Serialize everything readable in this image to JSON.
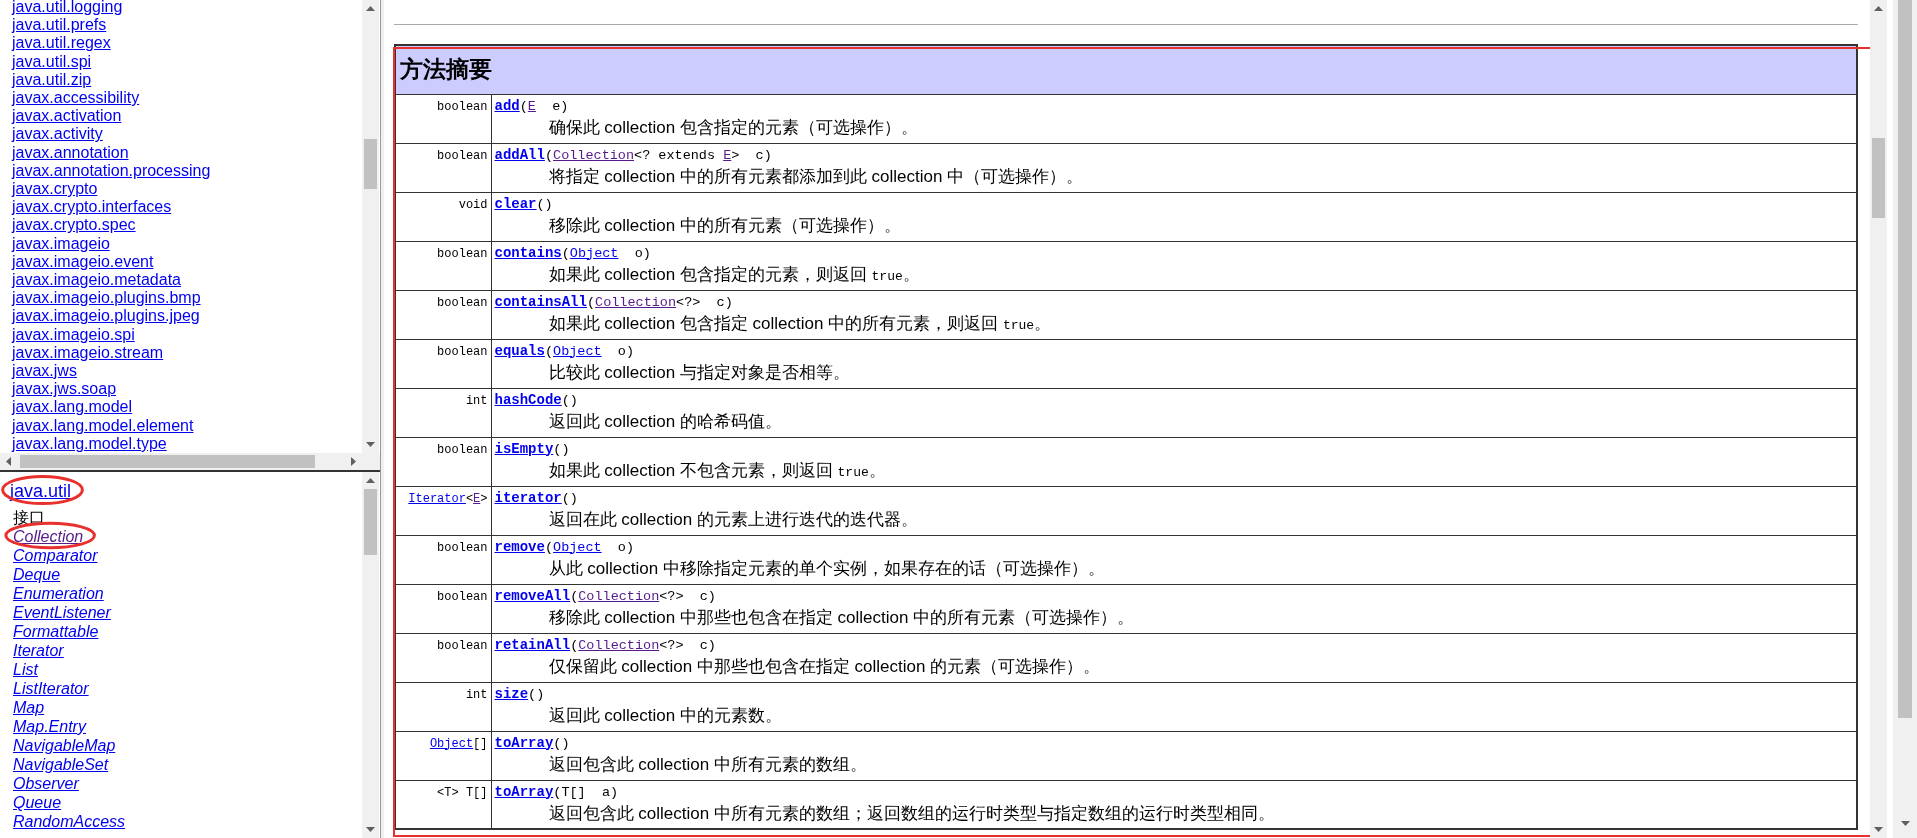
{
  "packages": [
    {
      "label": "java.util.logging"
    },
    {
      "label": "java.util.prefs"
    },
    {
      "label": "java.util.regex"
    },
    {
      "label": "java.util.spi"
    },
    {
      "label": "java.util.zip"
    },
    {
      "label": "javax.accessibility"
    },
    {
      "label": "javax.activation"
    },
    {
      "label": "javax.activity"
    },
    {
      "label": "javax.annotation"
    },
    {
      "label": "javax.annotation.processing"
    },
    {
      "label": "javax.crypto"
    },
    {
      "label": "javax.crypto.interfaces"
    },
    {
      "label": "javax.crypto.spec"
    },
    {
      "label": "javax.imageio"
    },
    {
      "label": "javax.imageio.event"
    },
    {
      "label": "javax.imageio.metadata"
    },
    {
      "label": "javax.imageio.plugins.bmp"
    },
    {
      "label": "javax.imageio.plugins.jpeg"
    },
    {
      "label": "javax.imageio.spi"
    },
    {
      "label": "javax.imageio.stream"
    },
    {
      "label": "javax.jws"
    },
    {
      "label": "javax.jws.soap"
    },
    {
      "label": "javax.lang.model"
    },
    {
      "label": "javax.lang.model.element"
    },
    {
      "label": "javax.lang.model.type"
    }
  ],
  "package_frame": {
    "title": "java.util",
    "title_circled": true,
    "section": "接口",
    "classes": [
      {
        "label": "Collection",
        "visited": true,
        "circled": true
      },
      {
        "label": "Comparator",
        "visited": false,
        "circled": false
      },
      {
        "label": "Deque",
        "visited": false,
        "circled": false
      },
      {
        "label": "Enumeration",
        "visited": false,
        "circled": false
      },
      {
        "label": "EventListener",
        "visited": false,
        "circled": false
      },
      {
        "label": "Formattable",
        "visited": false,
        "circled": false
      },
      {
        "label": "Iterator",
        "visited": false,
        "circled": false
      },
      {
        "label": "List",
        "visited": false,
        "circled": false
      },
      {
        "label": "ListIterator",
        "visited": false,
        "circled": false
      },
      {
        "label": "Map",
        "visited": false,
        "circled": false
      },
      {
        "label": "Map.Entry",
        "visited": false,
        "circled": false
      },
      {
        "label": "NavigableMap",
        "visited": false,
        "circled": false
      },
      {
        "label": "NavigableSet",
        "visited": false,
        "circled": false
      },
      {
        "label": "Observer",
        "visited": false,
        "circled": false
      },
      {
        "label": "Queue",
        "visited": false,
        "circled": false
      },
      {
        "label": "RandomAccess",
        "visited": false,
        "circled": false
      }
    ]
  },
  "method_summary": {
    "title": "方法摘要",
    "outlined": true,
    "rows": [
      {
        "returns": [
          {
            "kind": "plain",
            "text": "boolean"
          }
        ],
        "signature": [
          {
            "kind": "method",
            "text": "add"
          },
          {
            "kind": "plain",
            "text": "("
          },
          {
            "kind": "visited",
            "text": "E"
          },
          {
            "kind": "plain",
            "text": "  e)"
          }
        ],
        "description": [
          {
            "kind": "plain",
            "text": "确保此 collection 包含指定的元素（可选操作）。"
          }
        ]
      },
      {
        "returns": [
          {
            "kind": "plain",
            "text": "boolean"
          }
        ],
        "signature": [
          {
            "kind": "method",
            "text": "addAll"
          },
          {
            "kind": "plain",
            "text": "("
          },
          {
            "kind": "visited",
            "text": "Collection"
          },
          {
            "kind": "plain",
            "text": "<? extends "
          },
          {
            "kind": "visited",
            "text": "E"
          },
          {
            "kind": "plain",
            "text": ">  c)"
          }
        ],
        "description": [
          {
            "kind": "plain",
            "text": "将指定 collection 中的所有元素都添加到此 collection 中（可选操作）。"
          }
        ]
      },
      {
        "returns": [
          {
            "kind": "plain",
            "text": "void"
          }
        ],
        "signature": [
          {
            "kind": "method",
            "text": "clear"
          },
          {
            "kind": "plain",
            "text": "()"
          }
        ],
        "description": [
          {
            "kind": "plain",
            "text": "移除此 collection 中的所有元素（可选操作）。"
          }
        ]
      },
      {
        "returns": [
          {
            "kind": "plain",
            "text": "boolean"
          }
        ],
        "signature": [
          {
            "kind": "method",
            "text": "contains"
          },
          {
            "kind": "plain",
            "text": "("
          },
          {
            "kind": "link",
            "text": "Object"
          },
          {
            "kind": "plain",
            "text": "  o)"
          }
        ],
        "description": [
          {
            "kind": "plain",
            "text": "如果此 collection 包含指定的元素，则返回 "
          },
          {
            "kind": "code",
            "text": "true"
          },
          {
            "kind": "plain",
            "text": "。"
          }
        ]
      },
      {
        "returns": [
          {
            "kind": "plain",
            "text": "boolean"
          }
        ],
        "signature": [
          {
            "kind": "method",
            "text": "containsAll"
          },
          {
            "kind": "plain",
            "text": "("
          },
          {
            "kind": "visited",
            "text": "Collection"
          },
          {
            "kind": "plain",
            "text": "<?>  c)"
          }
        ],
        "description": [
          {
            "kind": "plain",
            "text": "如果此 collection 包含指定 collection 中的所有元素，则返回 "
          },
          {
            "kind": "code",
            "text": "true"
          },
          {
            "kind": "plain",
            "text": "。"
          }
        ]
      },
      {
        "returns": [
          {
            "kind": "plain",
            "text": "boolean"
          }
        ],
        "signature": [
          {
            "kind": "method",
            "text": "equals"
          },
          {
            "kind": "plain",
            "text": "("
          },
          {
            "kind": "link",
            "text": "Object"
          },
          {
            "kind": "plain",
            "text": "  o)"
          }
        ],
        "description": [
          {
            "kind": "plain",
            "text": "比较此 collection 与指定对象是否相等。"
          }
        ]
      },
      {
        "returns": [
          {
            "kind": "plain",
            "text": "int"
          }
        ],
        "signature": [
          {
            "kind": "method",
            "text": "hashCode"
          },
          {
            "kind": "plain",
            "text": "()"
          }
        ],
        "description": [
          {
            "kind": "plain",
            "text": "返回此 collection 的哈希码值。"
          }
        ]
      },
      {
        "returns": [
          {
            "kind": "plain",
            "text": "boolean"
          }
        ],
        "signature": [
          {
            "kind": "method",
            "text": "isEmpty"
          },
          {
            "kind": "plain",
            "text": "()"
          }
        ],
        "description": [
          {
            "kind": "plain",
            "text": "如果此 collection 不包含元素，则返回 "
          },
          {
            "kind": "code",
            "text": "true"
          },
          {
            "kind": "plain",
            "text": "。"
          }
        ]
      },
      {
        "returns": [
          {
            "kind": "link",
            "text": "Iterator"
          },
          {
            "kind": "plain",
            "text": "<"
          },
          {
            "kind": "visited",
            "text": "E"
          },
          {
            "kind": "plain",
            "text": ">"
          }
        ],
        "signature": [
          {
            "kind": "method",
            "text": "iterator"
          },
          {
            "kind": "plain",
            "text": "()"
          }
        ],
        "description": [
          {
            "kind": "plain",
            "text": "返回在此 collection 的元素上进行迭代的迭代器。"
          }
        ]
      },
      {
        "returns": [
          {
            "kind": "plain",
            "text": "boolean"
          }
        ],
        "signature": [
          {
            "kind": "method",
            "text": "remove"
          },
          {
            "kind": "plain",
            "text": "("
          },
          {
            "kind": "link",
            "text": "Object"
          },
          {
            "kind": "plain",
            "text": "  o)"
          }
        ],
        "description": [
          {
            "kind": "plain",
            "text": "从此 collection 中移除指定元素的单个实例，如果存在的话（可选操作）。"
          }
        ]
      },
      {
        "returns": [
          {
            "kind": "plain",
            "text": "boolean"
          }
        ],
        "signature": [
          {
            "kind": "method",
            "text": "removeAll"
          },
          {
            "kind": "plain",
            "text": "("
          },
          {
            "kind": "visited",
            "text": "Collection"
          },
          {
            "kind": "plain",
            "text": "<?>  c)"
          }
        ],
        "description": [
          {
            "kind": "plain",
            "text": "移除此 collection 中那些也包含在指定 collection 中的所有元素（可选操作）。"
          }
        ]
      },
      {
        "returns": [
          {
            "kind": "plain",
            "text": "boolean"
          }
        ],
        "signature": [
          {
            "kind": "method",
            "text": "retainAll"
          },
          {
            "kind": "plain",
            "text": "("
          },
          {
            "kind": "visited",
            "text": "Collection"
          },
          {
            "kind": "plain",
            "text": "<?>  c)"
          }
        ],
        "description": [
          {
            "kind": "plain",
            "text": "仅保留此 collection 中那些也包含在指定 collection 的元素（可选操作）。"
          }
        ]
      },
      {
        "returns": [
          {
            "kind": "plain",
            "text": "int"
          }
        ],
        "signature": [
          {
            "kind": "method",
            "text": "size"
          },
          {
            "kind": "plain",
            "text": "()"
          }
        ],
        "description": [
          {
            "kind": "plain",
            "text": "返回此 collection 中的元素数。"
          }
        ]
      },
      {
        "returns": [
          {
            "kind": "link",
            "text": "Object"
          },
          {
            "kind": "plain",
            "text": "[]"
          }
        ],
        "signature": [
          {
            "kind": "method",
            "text": "toArray"
          },
          {
            "kind": "plain",
            "text": "()"
          }
        ],
        "description": [
          {
            "kind": "plain",
            "text": "返回包含此 collection 中所有元素的数组。"
          }
        ]
      },
      {
        "returns": [
          {
            "kind": "plain",
            "text": "<T> T[]"
          }
        ],
        "signature": [
          {
            "kind": "method",
            "text": "toArray"
          },
          {
            "kind": "plain",
            "text": "(T[]  a)"
          }
        ],
        "description": [
          {
            "kind": "plain",
            "text": "返回包含此 collection 中所有元素的数组；返回数组的运行时类型与指定数组的运行时类型相同。"
          }
        ]
      }
    ]
  }
}
